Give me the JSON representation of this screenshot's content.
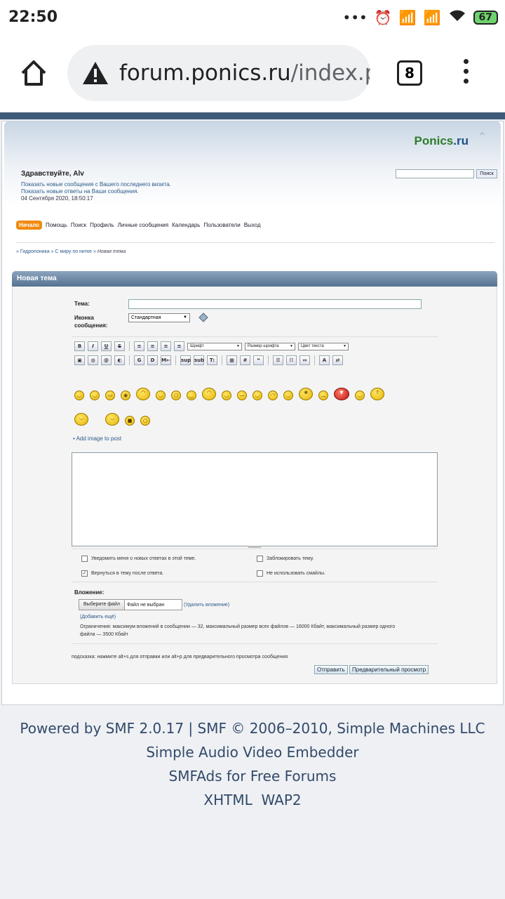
{
  "status_bar": {
    "time": "22:50",
    "battery": "67"
  },
  "browser": {
    "url_host": "forum.ponics.ru",
    "url_path": "/index.p",
    "tabs_count": "8"
  },
  "header": {
    "logo_main": "Ponics",
    "logo_tld": ".ru",
    "greeting": "Здравствуйте, Alv",
    "link_new_posts": "Показать новые сообщения с Вашего последнего визита.",
    "link_new_replies": "Показать новые ответы на Ваши сообщения.",
    "datetime": "04 Сентября 2020, 18:50:17",
    "search_button": "Поиск"
  },
  "nav": [
    {
      "label": "Начало",
      "active": true
    },
    {
      "label": "Помощь"
    },
    {
      "label": "Поиск"
    },
    {
      "label": "Профиль"
    },
    {
      "label": "Личные сообщения"
    },
    {
      "label": "Календарь"
    },
    {
      "label": "Пользователи"
    },
    {
      "label": "Выход"
    }
  ],
  "breadcrumb": {
    "b1": "Гидропоника",
    "b2": "С миру по нитке",
    "b3": "Новая тема",
    "sep": "»"
  },
  "post": {
    "title": "Новая тема",
    "subject_label": "Тема:",
    "icon_label_1": "Иконка",
    "icon_label_2": "сообщения:",
    "icon_select": "Стандартная",
    "font_select": "Шрифт",
    "size_select": "Размер шрифта",
    "color_select": "Цвет текста",
    "add_image": "• Add image to post",
    "opt_notify": "Уведомить меня о новых ответах в этой теме.",
    "opt_return": "Вернуться в тему после ответа.",
    "opt_lock": "Заблокировать тему.",
    "opt_nosmiley": "Не использовать смайлы.",
    "attach_label": "Вложение:",
    "file_button": "Выберите файл",
    "file_status": "Файл не выбран",
    "remove_attach": "(Удалить вложение)",
    "add_more": "(Добавить ещё)",
    "limits_1": "Ограничения: максимум вложений в сообщении — 32, максимальный размер всех файлов — 16000 Кбайт, максимальный размер одного",
    "limits_2": "файла — 3500 Кбайт",
    "hint": "подсказка: нажмите alt+s для отправки или alt+p для предварительного просмотра сообщения",
    "send_button": "Отправить",
    "preview_button": "Предварительный просмотр"
  },
  "toolbar_buttons": {
    "bold": "B",
    "italic": "I",
    "underline": "U",
    "strike": "S",
    "glow": "G",
    "shadow": "D",
    "marquee": "M←",
    "sup": "sup",
    "sub": "sub",
    "tt": "T:",
    "hash": "#"
  },
  "footer": {
    "line1": "Powered by SMF 2.0.17 | SMF © 2006–2010, Simple Machines LLC",
    "line2": "Simple Audio Video Embedder",
    "line3": "SMFAds for Free Forums",
    "xhtml": "XHTML",
    "wap2": "WAP2"
  },
  "colors": {
    "accent": "#f08a10",
    "header_bar": "#55728f",
    "link": "#2a5a8a"
  }
}
